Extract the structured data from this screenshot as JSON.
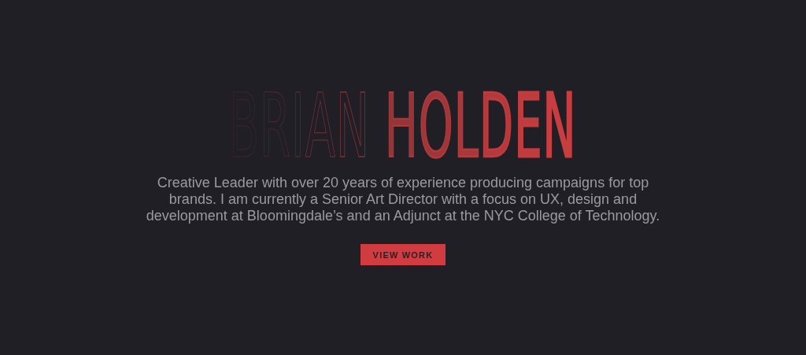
{
  "name": "BRIAN HOLDEN",
  "bio": "Creative Leader with over 20 years of experience producing campaigns for top brands. I am currently a Senior Art Director with a focus on UX, design and development at Bloomingdale’s and an Adjunct at the NYC College of Technology.",
  "button": "VIEW WORK"
}
